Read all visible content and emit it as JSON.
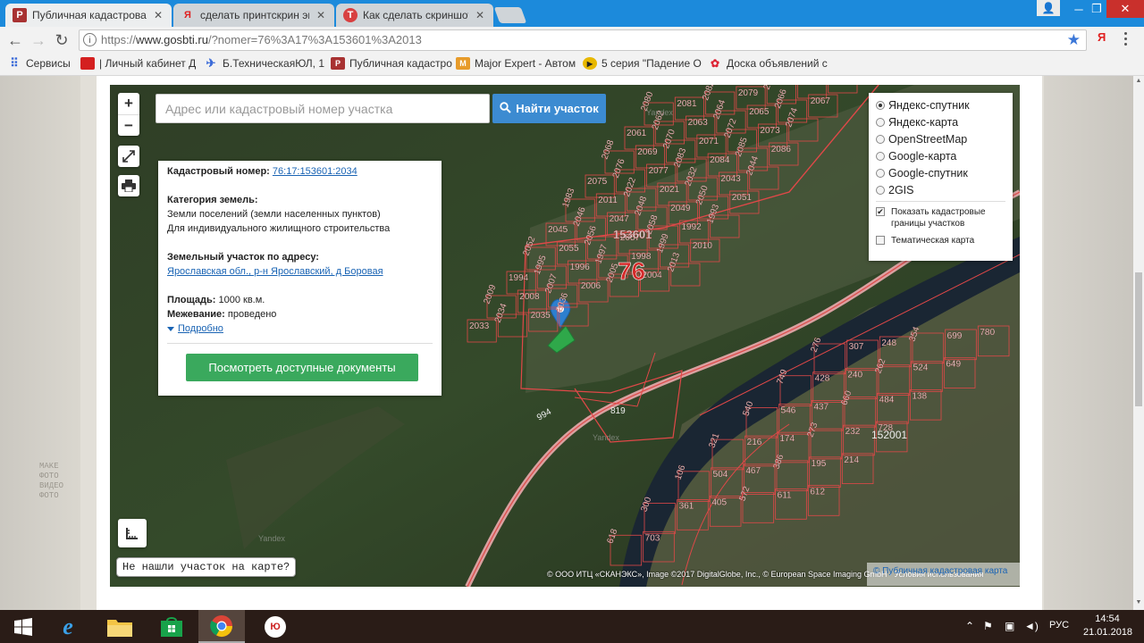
{
  "browser": {
    "tabs": [
      {
        "title": "Публичная кадастровая",
        "favicon": "rosreestr-icon",
        "active": true
      },
      {
        "title": "сделать принтскрин экр",
        "favicon": "yandex-icon",
        "active": false
      },
      {
        "title": "Как сделать скриншот",
        "favicon": "tutorial-icon",
        "active": false
      }
    ],
    "user_badge": "👤",
    "window_controls": {
      "minimize": "─",
      "restore": "❐",
      "close": "✕"
    },
    "address": {
      "scheme": "https://",
      "host": "www.gosbti.ru",
      "path": "/?nomer=76%3A17%3A153601%3A2013"
    },
    "extension_label": "Я",
    "bookmarks": [
      {
        "label": "Сервисы",
        "icon": "apps-grid-icon"
      },
      {
        "label": "| Личный кабинет Д",
        "icon": "cabinet-icon"
      },
      {
        "label": "Б.ТехническаяЮЛ, 1",
        "icon": "plane-icon"
      },
      {
        "label": "Публичная кадастро",
        "icon": "rosreestr-icon"
      },
      {
        "label": "Major Expert - Автом",
        "icon": "major-icon"
      },
      {
        "label": "5 серия \"Падение О",
        "icon": "play-icon"
      },
      {
        "label": "Доска объявлений с",
        "icon": "board-icon"
      }
    ]
  },
  "map": {
    "search": {
      "placeholder": "Адрес или кадастровый номер участка",
      "button": "Найти участок"
    },
    "zoom_in": "+",
    "zoom_out": "−",
    "info": {
      "cad_label": "Кадастровый номер:",
      "cad_value": "76:17:153601:2034",
      "category_label": "Категория земель:",
      "category_line1": "Земли поселений (земли населенных пунктов)",
      "category_line2": "Для индивидуального жилищного строительства",
      "address_label": "Земельный участок по адресу:",
      "address_value": "Ярославская обл., р-н Ярославский, д Боровая",
      "area_label": "Площадь:",
      "area_value": "1000 кв.м.",
      "survey_label": "Межевание:",
      "survey_value": "проведено",
      "more_label": "Подробно",
      "docs_button": "Посмотреть доступные документы"
    },
    "layers": {
      "options": [
        {
          "label": "Яндекс-спутник",
          "selected": true
        },
        {
          "label": "Яндекс-карта",
          "selected": false
        },
        {
          "label": "OpenStreetMap",
          "selected": false
        },
        {
          "label": "Google-карта",
          "selected": false
        },
        {
          "label": "Google-спутник",
          "selected": false
        },
        {
          "label": "2GIS",
          "selected": false
        }
      ],
      "show_borders": {
        "label": "Показать кадастровые границы участков",
        "checked": true
      },
      "thematic": {
        "label": "Тематическая карта",
        "checked": false
      }
    },
    "labels": {
      "region": "76",
      "quarter_north": "153601",
      "quarter_south": "152001",
      "road": "994",
      "plot_819": "819",
      "watermark": "Yandex"
    },
    "plot_numbers_north": [
      "2080",
      "2081",
      "2082",
      "2079",
      "2078",
      "2059",
      "2060",
      "2061",
      "2062",
      "2063",
      "2064",
      "2065",
      "2066",
      "2067",
      "2068",
      "2069",
      "2070",
      "2071",
      "2072",
      "2073",
      "2074",
      "2075",
      "2076",
      "2077",
      "2083",
      "2084",
      "2085",
      "2086",
      "1983",
      "2011",
      "2022",
      "2021",
      "2032",
      "2043",
      "2044",
      "2045",
      "2046",
      "2047",
      "2048",
      "2049",
      "2050",
      "2051",
      "2052",
      "2055",
      "2056",
      "2057",
      "2058",
      "1992",
      "1993",
      "1994",
      "1995",
      "1996",
      "1997",
      "1998",
      "1999",
      "2010",
      "2009",
      "2008",
      "2007",
      "2006",
      "2005",
      "2004",
      "2013",
      "2033",
      "2034",
      "2035",
      "2036"
    ],
    "plot_numbers_south": [
      "276",
      "307",
      "248",
      "354",
      "699",
      "780",
      "749",
      "428",
      "240",
      "262",
      "524",
      "649",
      "540",
      "546",
      "437",
      "660",
      "484",
      "138",
      "321",
      "216",
      "174",
      "273",
      "232",
      "728",
      "106",
      "504",
      "467",
      "386",
      "195",
      "214",
      "300",
      "361",
      "405",
      "572",
      "611",
      "612",
      "618",
      "703"
    ],
    "not_found": "Не нашли участок на карте?",
    "attribution": "© ООО ИТЦ «СКАНЭКС», Image ©2017 DigitalGlobe, Inc., © European Space Imaging GmbH · Условия использования",
    "attribution_link": "© Публичная кадастровая карта"
  },
  "page_bg": {
    "stamp_lines": [
      "MAKE",
      "ФОТО",
      "ВИДЕО",
      "ФОТО"
    ]
  },
  "taskbar": {
    "apps": [
      {
        "name": "windows-start",
        "icon": "windows-icon"
      },
      {
        "name": "internet-explorer",
        "icon": "ie-icon"
      },
      {
        "name": "file-explorer",
        "icon": "folder-icon"
      },
      {
        "name": "store",
        "icon": "store-icon"
      },
      {
        "name": "chrome",
        "icon": "chrome-icon",
        "active": true
      },
      {
        "name": "yandex",
        "icon": "yu-icon"
      }
    ],
    "tray": {
      "language": "РУС",
      "time": "14:54",
      "date": "21.01.2018"
    }
  },
  "colors": {
    "chrome_frame": "#1c8adb",
    "search_button": "#3c8bd1",
    "docs_button": "#3aa95d",
    "link": "#1a64b4",
    "parcel_border": "#e04848",
    "parcel_label": "#f3eeee",
    "selected_parcel": "#2fa84a",
    "marker": "#2d7fcf"
  }
}
